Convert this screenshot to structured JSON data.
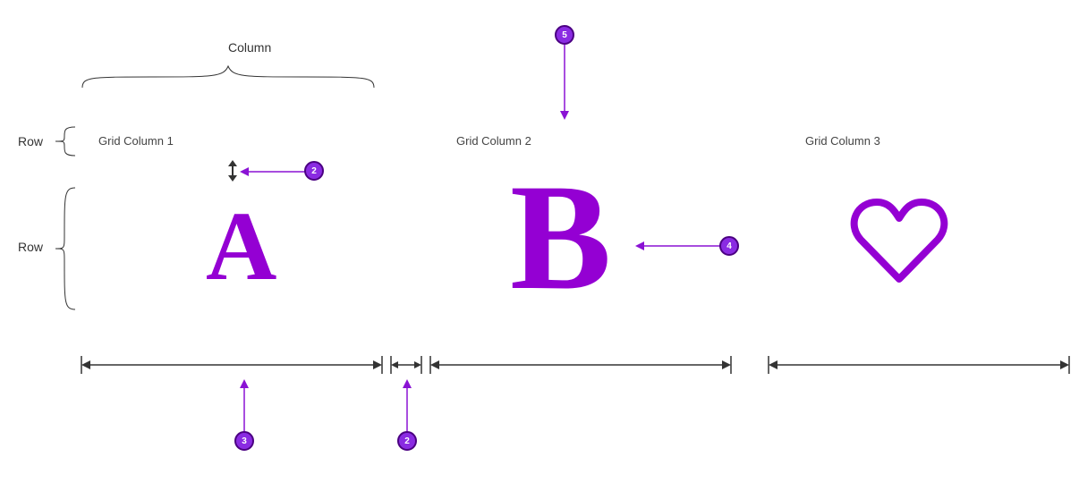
{
  "labels": {
    "column": "Column",
    "row1": "Row",
    "row2": "Row",
    "col1": "Grid Column 1",
    "col2": "Grid Column 2",
    "col3": "Grid Column 3"
  },
  "cells": {
    "a": "A",
    "b": "B"
  },
  "callouts": {
    "c2top": "2",
    "c3": "3",
    "c2bottom": "2",
    "c4": "4",
    "c5": "5"
  },
  "colors": {
    "accent": "#9400d3",
    "callout_fill": "#8a2be2",
    "callout_border": "#4b0082",
    "ink": "#333333"
  }
}
